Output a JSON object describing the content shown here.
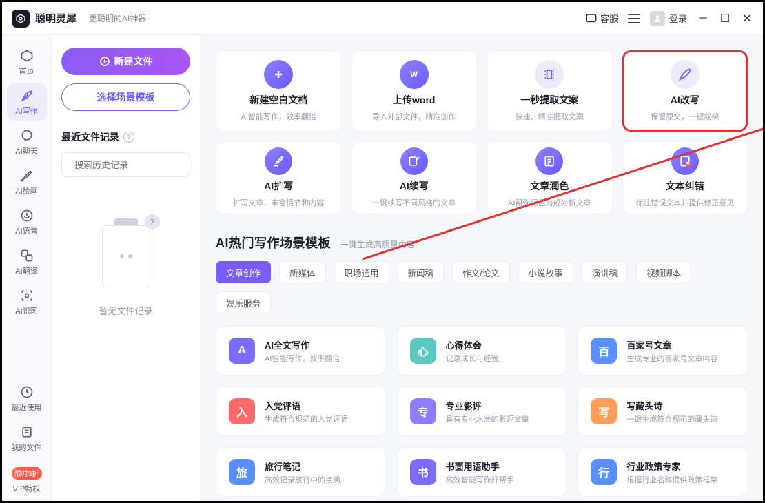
{
  "titlebar": {
    "app_name": "聪明灵犀",
    "subtitle": "更聪明的AI神器",
    "support": "客服",
    "login": "登录"
  },
  "sidebar": {
    "items": [
      {
        "label": "首页"
      },
      {
        "label": "AI写作"
      },
      {
        "label": "AI聊天"
      },
      {
        "label": "AI绘画"
      },
      {
        "label": "AI语音"
      },
      {
        "label": "AI翻译"
      },
      {
        "label": "AI识图"
      }
    ],
    "bottom": [
      {
        "label": "最近使用"
      },
      {
        "label": "我的文件"
      },
      {
        "label": "VIP特权",
        "badge": "限时3折"
      }
    ]
  },
  "filepane": {
    "new_btn": "新建文件",
    "tpl_btn": "选择场景模板",
    "recent_title": "最近文件记录",
    "search_placeholder": "搜索历史记录",
    "empty": "暂无文件记录"
  },
  "features_top": [
    {
      "title": "新建空白文档",
      "desc": "AI智能写作，效率翻倍",
      "icon": "plus"
    },
    {
      "title": "上传word",
      "desc": "导入外部文件，精准创作",
      "icon": "word"
    },
    {
      "title": "一秒提取文案",
      "desc": "快速、精准提取文案",
      "icon": "extract"
    },
    {
      "title": "AI改写",
      "desc": "保留原文，一键成稿",
      "icon": "rewrite",
      "highlight": true
    }
  ],
  "features_mid": [
    {
      "title": "AI扩写",
      "desc": "扩写文章，丰富情节和内容",
      "icon": "expand"
    },
    {
      "title": "AI续写",
      "desc": "一键续写不同风格的文章",
      "icon": "continue"
    },
    {
      "title": "文章润色",
      "desc": "AI帮你润色为成为新文章",
      "icon": "polish"
    },
    {
      "title": "文本纠错",
      "desc": "标注错误文本并提供修正意见",
      "icon": "correct"
    }
  ],
  "template_section": {
    "title": "AI热门写作场景模板",
    "subtitle": "一键生成高质量内容",
    "tabs": [
      "文章创作",
      "新媒体",
      "职场通用",
      "新闻稿",
      "作文/论文",
      "小说故事",
      "演讲稿",
      "视频脚本",
      "娱乐服务"
    ],
    "cards": [
      {
        "title": "AI全文写作",
        "desc": "AI智能写作，效率翻倍",
        "color": "#7a6cff"
      },
      {
        "title": "心得体会",
        "desc": "记录成长与经验",
        "color": "#5bc9c0"
      },
      {
        "title": "百家号文章",
        "desc": "生成专业的百家号文章内容",
        "color": "#5b8fff"
      },
      {
        "title": "入党评语",
        "desc": "生成符合规范的入党评语",
        "color": "#ff6b6b"
      },
      {
        "title": "专业影评",
        "desc": "具有专业水准的影评文章",
        "color": "#8b7fff"
      },
      {
        "title": "写藏头诗",
        "desc": "一键生成符合规范的藏头诗",
        "color": "#ff9e5a"
      },
      {
        "title": "旅行笔记",
        "desc": "高效记录旅行中的点滴",
        "color": "#5b8fff"
      },
      {
        "title": "书面用语助手",
        "desc": "高效智能写作好帮手",
        "color": "#7a6cff"
      },
      {
        "title": "行业政策专家",
        "desc": "根据行业名称提供政策框架",
        "color": "#5b8fff"
      }
    ]
  }
}
